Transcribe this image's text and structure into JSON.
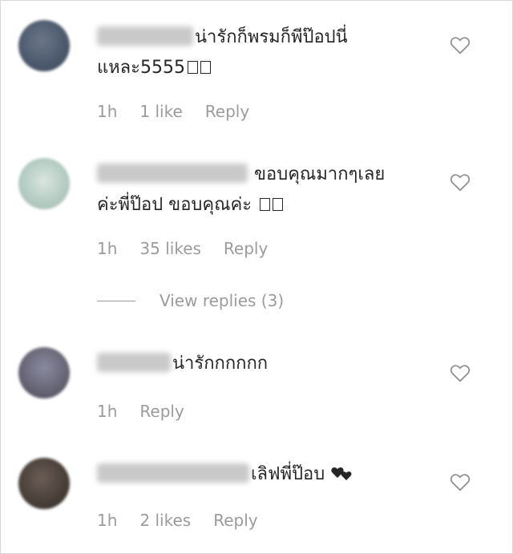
{
  "comments": [
    {
      "text_line1": "น่ารักก็พรมก็พีป๊อปนี่",
      "text_line2": "แหละ5555",
      "time": "1h",
      "likes": "1 like",
      "reply": "Reply",
      "avatar_color": "#4d5a6e",
      "icon": "heart-outline-icon"
    },
    {
      "text_line1": "ขอบคุณมากๆเลย",
      "text_line2": "ค่ะพี่ป๊อป ขอบคุณค่ะ",
      "time": "1h",
      "likes": "35 likes",
      "reply": "Reply",
      "avatar_color": "#b8cfc5",
      "icon": "heart-outline-icon"
    },
    {
      "text_line1": "น่ารักกกกกก",
      "time": "1h",
      "reply": "Reply",
      "avatar_color": "#6b6a7a",
      "icon": "heart-outline-icon"
    },
    {
      "text_line1": "เลิฟพี่ป๊อบ",
      "time": "1h",
      "likes": "2 likes",
      "reply": "Reply",
      "avatar_color": "#4a403a",
      "icon": "heart-outline-icon"
    }
  ],
  "view_replies": "View replies (3)",
  "emoji_icon": "two-hearts-icon"
}
